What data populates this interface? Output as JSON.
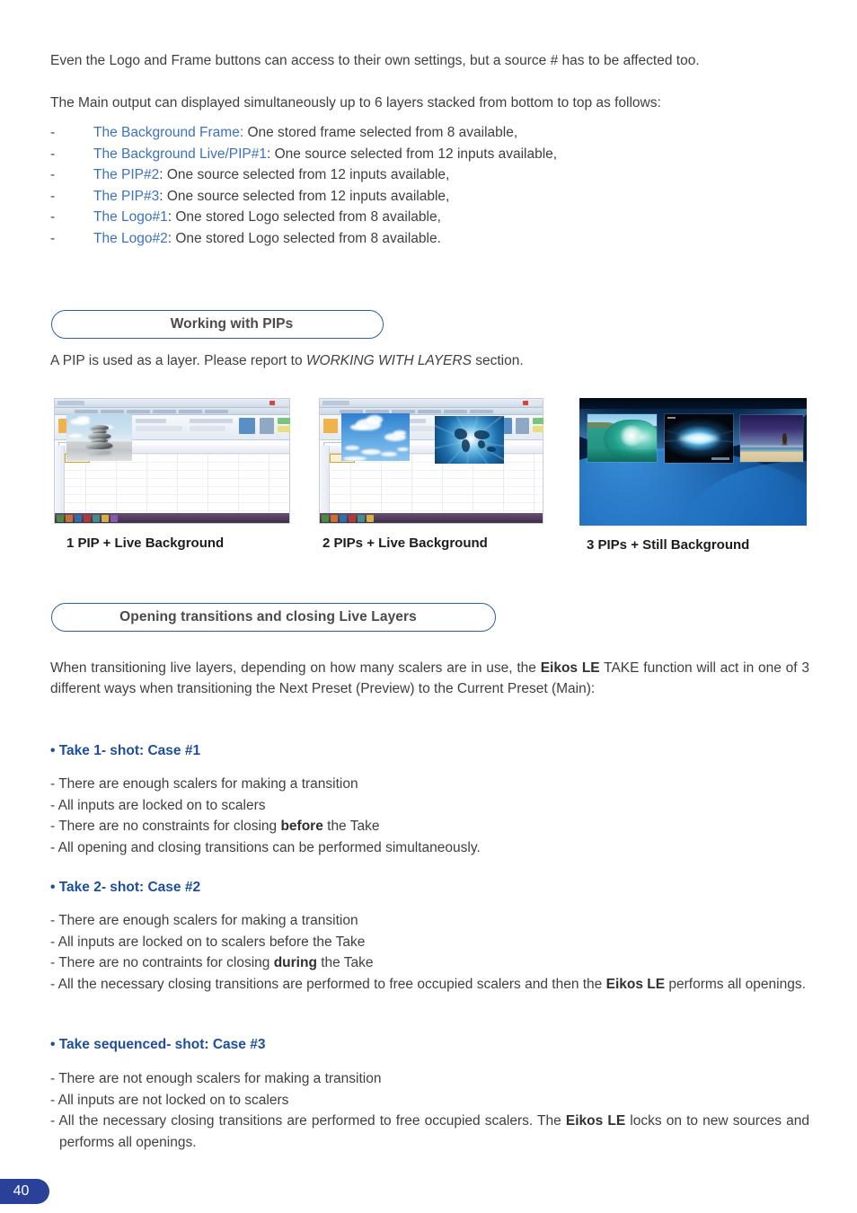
{
  "document": {
    "page_number": "40",
    "intro_paragraph_1": "Even the Logo and Frame buttons can access to their own settings, but a source # has to be affected too.",
    "intro_paragraph_2": "The Main output can displayed simultaneously up to 6 layers stacked from bottom to top as follows:"
  },
  "layers": {
    "bullet_marker": "-",
    "items": [
      {
        "label": "The Background Frame:",
        "description": " One stored frame selected from 8 available,"
      },
      {
        "label": "The Background Live/PIP#1",
        "description": ": One source selected from 12 inputs available,"
      },
      {
        "label": "The PIP#2",
        "description": ": One source selected from 12 inputs available,"
      },
      {
        "label": "The PIP#3",
        "description": ": One source selected from 12 inputs available,"
      },
      {
        "label": "The Logo#1",
        "description": ": One stored Logo selected from 8 available,"
      },
      {
        "label": "The Logo#2",
        "description": ": One stored Logo selected from 8 available."
      }
    ]
  },
  "section_pips": {
    "title": "Working with PIPs",
    "note_before_italic": "A PIP is used as a layer. Please report to ",
    "note_italic": "WORKING WITH LAYERS",
    "note_after_italic": " section.",
    "figures": [
      {
        "caption": "1 PIP + Live Background",
        "content": "excel-spreadsheet-with-one-pip",
        "pips": [
          "zen-stones"
        ]
      },
      {
        "caption": "2 PIPs + Live Background",
        "content": "excel-spreadsheet-with-two-pips",
        "pips": [
          "blue-sky-clouds",
          "abstract-blue-world-map"
        ]
      },
      {
        "caption": "3 PIPs + Still Background",
        "content": "blue-gradient-still-background-with-three-pips",
        "pips": [
          "ocean-wave",
          "energy-burst",
          "beach-with-surfer"
        ]
      }
    ]
  },
  "section_transitions": {
    "title": "Opening transitions and closing Live Layers",
    "paragraph": {
      "part1": "When transitioning live  layers, depending on how many scalers are in use, the ",
      "bold1": "Eikos LE",
      "part2": " TAKE function will act in one of 3 different ways when transitioning the Next Preset (Preview) to the Current Preset (Main):"
    },
    "cases": [
      {
        "heading": "• Take 1- shot: Case #1",
        "items": [
          {
            "prefix": "- There are enough scalers for making a transition",
            "bold": "",
            "suffix": ""
          },
          {
            "prefix": "- All inputs are locked on to scalers",
            "bold": "",
            "suffix": ""
          },
          {
            "prefix": "- There are no constraints for closing ",
            "bold": "before",
            "suffix": " the Take"
          },
          {
            "prefix": "- All opening and closing transitions can be performed simultaneously.",
            "bold": "",
            "suffix": ""
          }
        ]
      },
      {
        "heading": "• Take 2- shot: Case #2",
        "items": [
          {
            "prefix": "- There are enough scalers for making a transition",
            "bold": "",
            "suffix": ""
          },
          {
            "prefix": "- All inputs are locked on to scalers before the Take",
            "bold": "",
            "suffix": ""
          },
          {
            "prefix": "- There are no contraints for closing ",
            "bold": "during",
            "suffix": " the Take"
          },
          {
            "prefix": "- All the necessary closing transitions are performed to free occupied scalers and then the ",
            "bold": "Eikos LE",
            "suffix": " performs all openings."
          }
        ]
      },
      {
        "heading": "• Take sequenced- shot: Case #3",
        "items": [
          {
            "prefix": "- There are not enough scalers for making a transition",
            "bold": "",
            "suffix": ""
          },
          {
            "prefix": "- All inputs are not locked on to scalers",
            "bold": "",
            "suffix": ""
          },
          {
            "prefix": "- All the necessary closing transitions are performed to free occupied scalers. The ",
            "bold": "Eikos LE",
            "suffix": " locks on to new sources and performs all openings."
          }
        ]
      }
    ]
  },
  "colors": {
    "link_blue": "#3c72bf",
    "heading_blue": "#1d4e9e",
    "pill_border": "#2f5fa8",
    "page_tab": "#2b4099",
    "body_text": "#3f3f3f"
  }
}
